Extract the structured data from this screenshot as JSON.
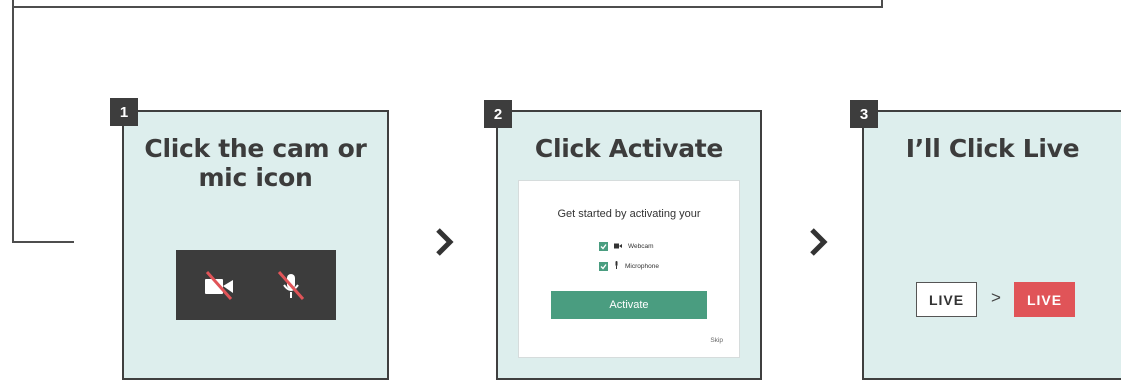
{
  "colors": {
    "panel_bg": "#ddeeed",
    "accent_green": "#4a9d80",
    "live_red": "#e05458",
    "dark": "#3c3c3c"
  },
  "steps": [
    {
      "number": "1",
      "title_line1": "Click the cam or",
      "title_line2": "mic icon",
      "icons": [
        "camera-off-icon",
        "microphone-off-icon"
      ]
    },
    {
      "number": "2",
      "title": "Click Activate",
      "dialog": {
        "prompt": "Get started by activating your",
        "webcam_label": "Webcam",
        "webcam_checked": true,
        "microphone_label": "Microphone",
        "microphone_checked": true,
        "activate_label": "Activate",
        "skip_label": "Skip"
      }
    },
    {
      "number": "3",
      "title": "I’ll Click Live",
      "live_before": "LIVE",
      "live_arrow": ">",
      "live_after": "LIVE"
    }
  ],
  "separators": [
    "chevron-right-icon",
    "chevron-right-icon"
  ]
}
